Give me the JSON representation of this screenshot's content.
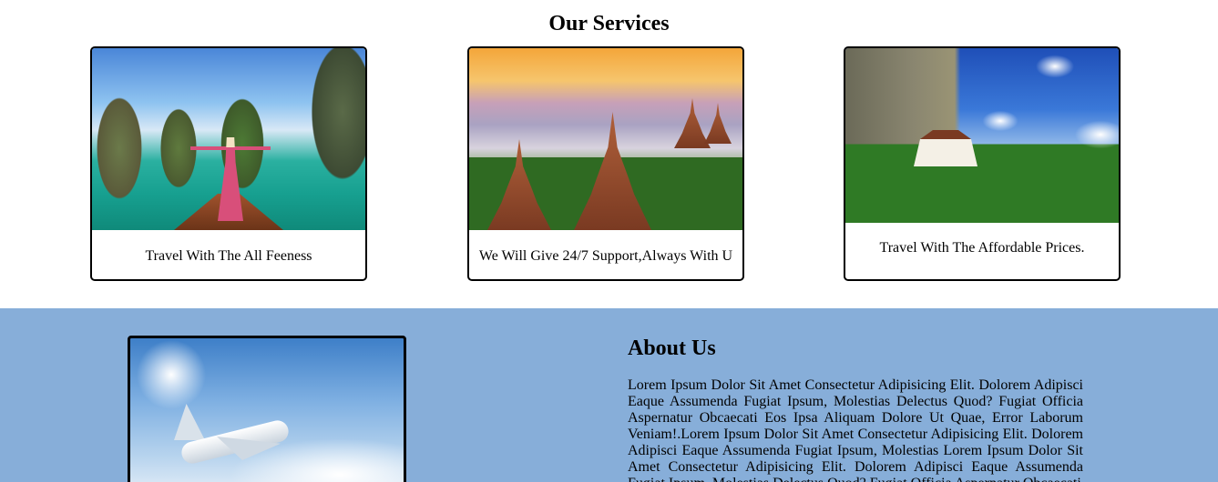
{
  "services": {
    "title": "Our Services",
    "cards": [
      {
        "caption": "Travel With The All Feeness"
      },
      {
        "caption": "We Will Give 24/7 Support,Always With U"
      },
      {
        "caption": "Travel With The Affordable Prices."
      }
    ]
  },
  "about": {
    "title": "About Us",
    "text": "Lorem Ipsum Dolor Sit Amet Consectetur Adipisicing Elit. Dolorem Adipisci Eaque Assumenda Fugiat Ipsum, Molestias Delectus Quod? Fugiat Officia Aspernatur Obcaecati Eos Ipsa Aliquam Dolore Ut Quae, Error Laborum Veniam!.Lorem Ipsum Dolor Sit Amet Consectetur Adipisicing Elit. Dolorem Adipisci Eaque Assumenda Fugiat Ipsum, Molestias Lorem Ipsum Dolor Sit Amet Consectetur Adipisicing Elit. Dolorem Adipisci Eaque Assumenda Fugiat Ipsum, Molestias Delectus Quod? Fugiat Officia Aspernatur Obcaecati"
  }
}
